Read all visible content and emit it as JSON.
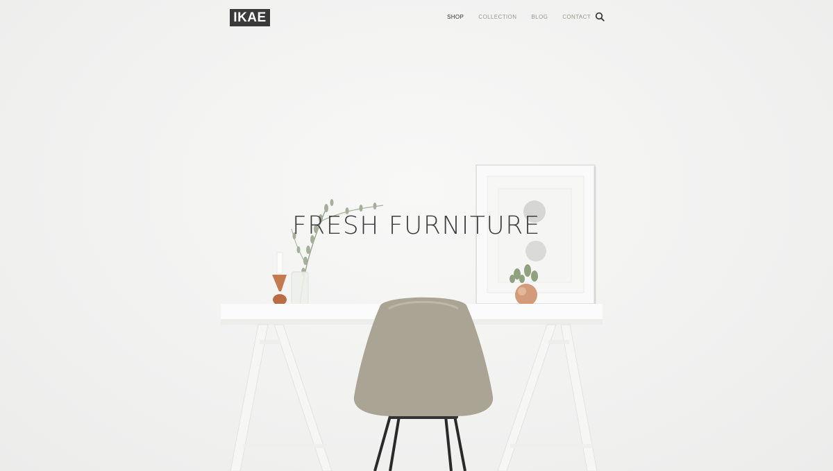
{
  "brand": {
    "logo_text": "IKAE"
  },
  "nav": {
    "items": [
      {
        "label": "SHOP",
        "active": true
      },
      {
        "label": "COLLECTION",
        "active": false
      },
      {
        "label": "BLOG",
        "active": false
      },
      {
        "label": "CONTACT",
        "active": false
      }
    ],
    "search_icon": "search-icon"
  },
  "hero": {
    "title": "FRESH FURNITURE"
  },
  "colors": {
    "logo_bg": "#3a3a3a",
    "nav_active": "#2f2f2f",
    "nav_inactive": "#9a968f",
    "chair": "#a8a394",
    "copper": "#c8805a"
  }
}
